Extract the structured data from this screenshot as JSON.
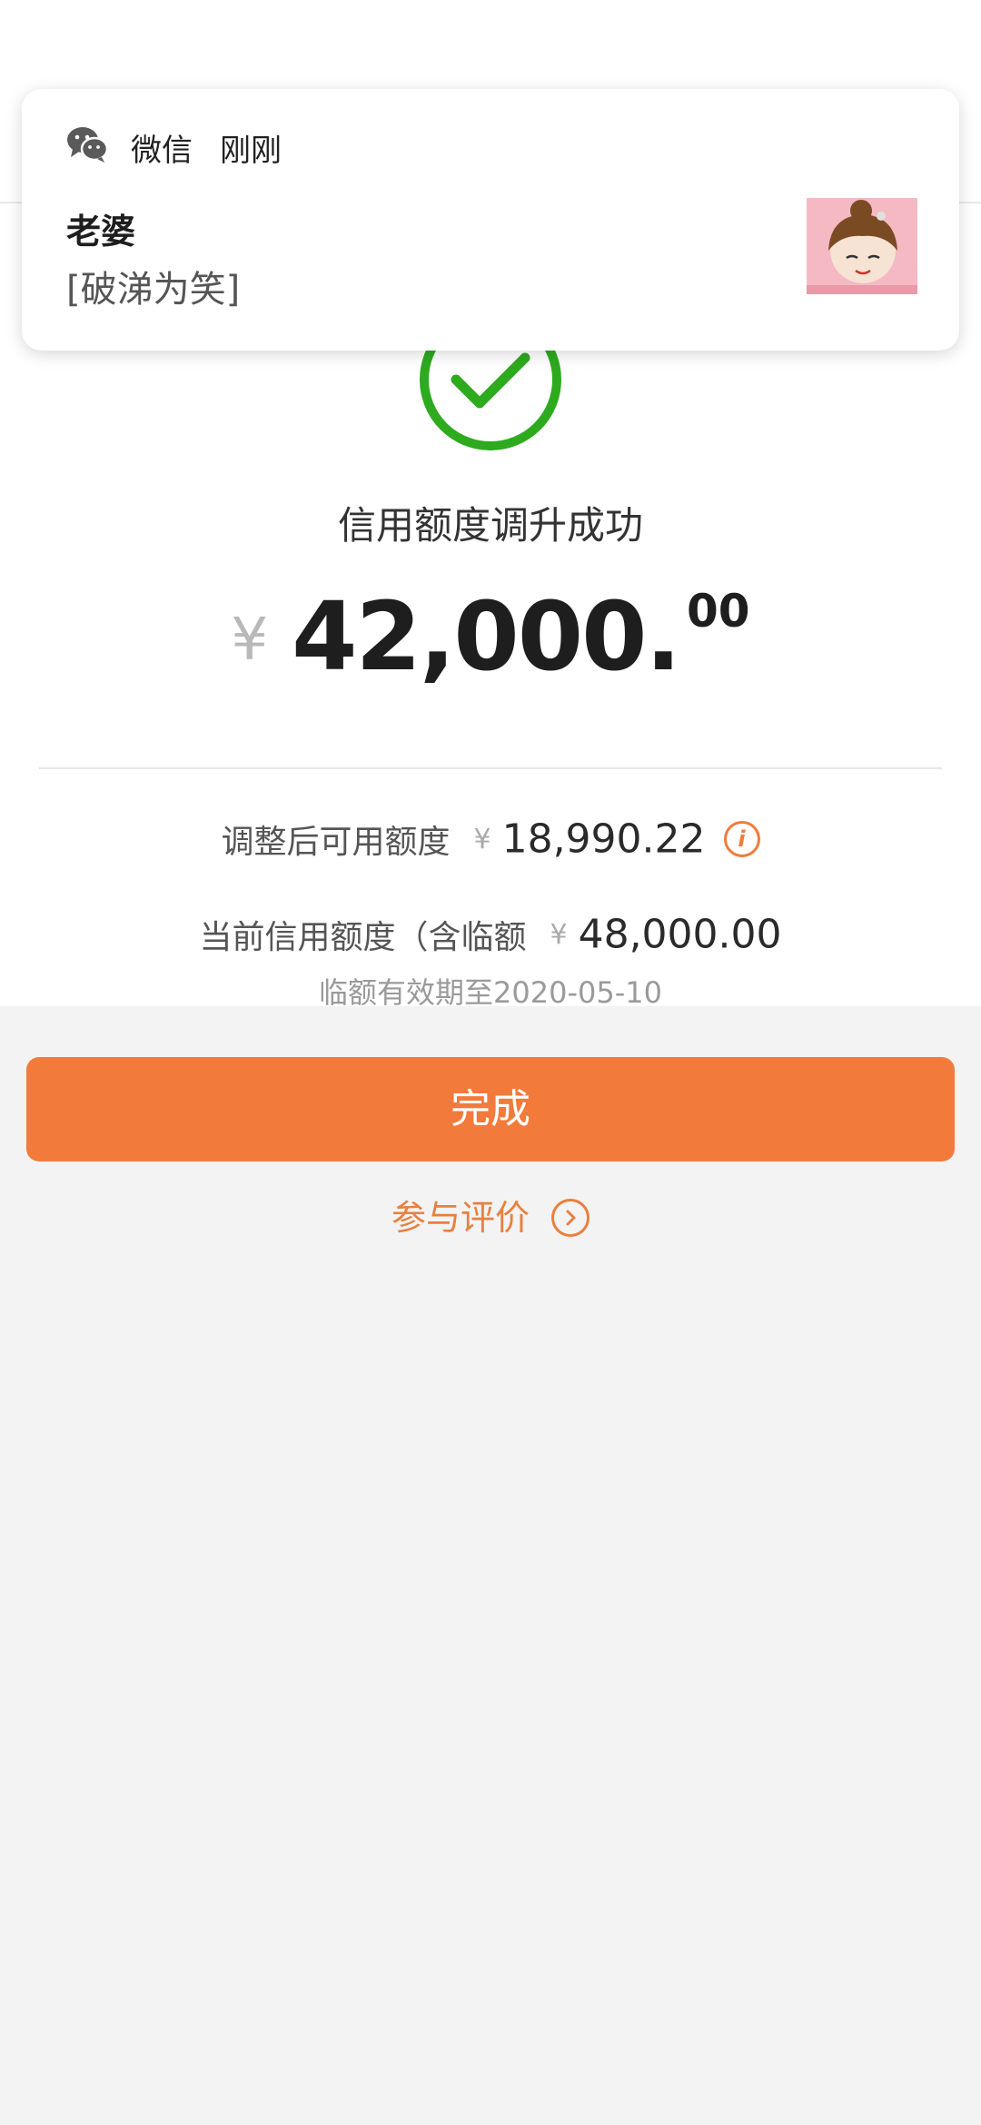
{
  "result": {
    "title": "信用额度调升成功",
    "currency_symbol": "¥",
    "amount_integer": "42,000.",
    "amount_decimal": "00"
  },
  "details": {
    "available_label": "调整后可用额度",
    "available_currency": "¥",
    "available_value": "18,990.22",
    "current_label": "当前信用额度（含临额",
    "current_currency": "¥",
    "current_value": "48,000.00",
    "temp_validity": "临额有效期至2020-05-10"
  },
  "actions": {
    "done_label": "完成",
    "review_label": "参与评价"
  },
  "notification": {
    "app_name": "微信",
    "time": "刚刚",
    "sender": "老婆",
    "message": "[破涕为笑]",
    "app_icon": "wechat-icon",
    "avatar": "cartoon-girl-avatar"
  },
  "colors": {
    "accent": "#f27b3b",
    "success": "#2eaa1f",
    "background": "#f3f3f3"
  }
}
